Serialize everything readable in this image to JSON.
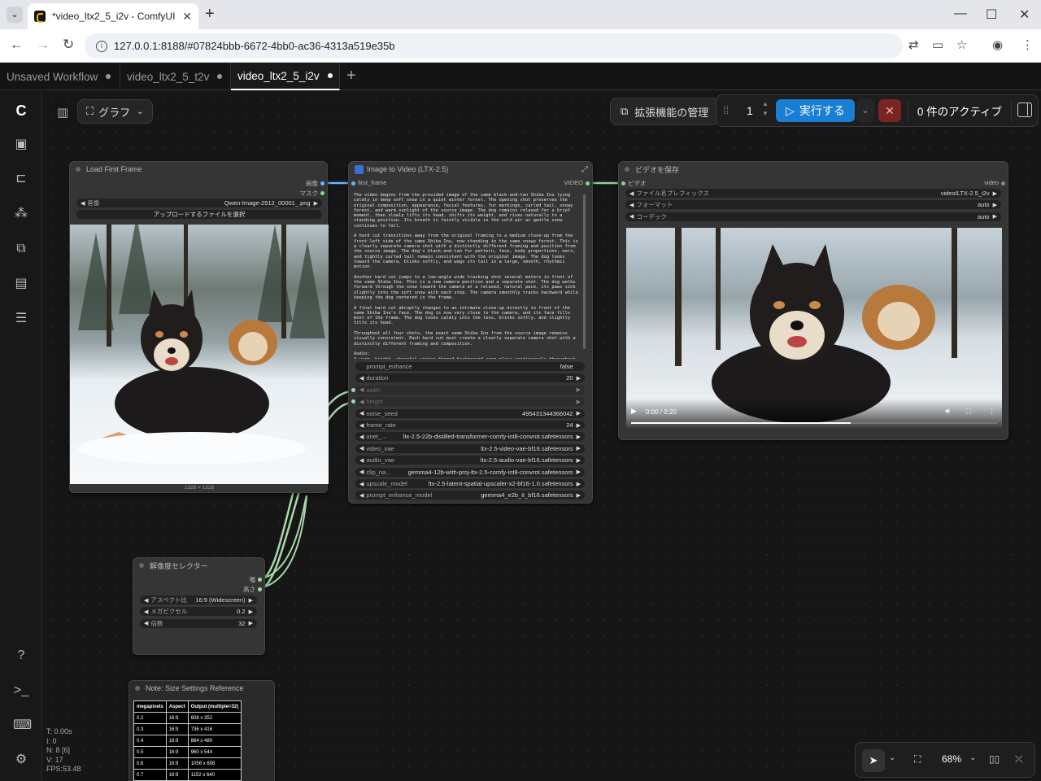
{
  "browser": {
    "tab_title": "*video_ltx2_5_i2v - ComfyUI",
    "url": "127.0.0.1:8188/#07824bbb-6672-4bb0-ac36-4313a519e35b"
  },
  "workflow_tabs": [
    {
      "label": "Unsaved Workflow"
    },
    {
      "label": "video_ltx2_5_t2v"
    },
    {
      "label": "video_ltx2_5_i2v"
    }
  ],
  "toolbar": {
    "graph_label": "グラフ",
    "extensions_label": "拡張機能の管理",
    "queue_count": "1",
    "run_label": "実行する",
    "active_label": "0 件のアクティブ"
  },
  "nodes": {
    "load_first_frame": {
      "title": "Load First Frame",
      "out_image": "画像",
      "out_mask": "マスク",
      "image_label": "画像",
      "image_value": "Qwen-Image-2512_00001_.png",
      "upload_label": "アップロードするファイルを選択",
      "size_caption": "1328 × 1328"
    },
    "image_to_video": {
      "title": "Image to Video (LTX-2.5)",
      "in_first_frame": "first_frame",
      "out_video": "VIDEO",
      "prompt_text": "The video begins from the provided image of the same black-and-tan Shiba Inu lying calmly in deep soft snow in a quiet winter forest. The opening shot preserves the original composition, appearance, facial features, fur markings, curled tail, snowy forest, and warm sunlight of the source image. The dog remains relaxed for a brief moment, then slowly lifts its head, shifts its weight, and rises naturally to a standing position. Its breath is faintly visible in the cold air as gentle snow continues to fall.\n\nA hard cut transitions away from the original framing to a medium close-up from the front-left side of the same Shiba Inu, now standing in the same snowy forest. This is a clearly separate camera shot with a distinctly different framing and position from the source image. The dog's black-and-tan fur pattern, face, body proportions, ears, and tightly curled tail remain consistent with the original image. The dog looks toward the camera, blinks softly, and wags its tail in a large, smooth, rhythmic motion.\n\nAnother hard cut jumps to a low-angle wide tracking shot several meters in front of the same Shiba Inu. This is a new camera position and a separate shot. The dog walks forward through the snow toward the camera at a relaxed, natural pace, its paws sink slightly into the soft snow with each step. The camera smoothly tracks backward while keeping the dog centered in the frame.\n\nA final hard cut abruptly changes to an intimate close-up directly in front of the same Shiba Inu's face. The dog is now very close to the camera, and its face fills most of the frame. The dog looks calmly into the lens, blinks softly, and slightly tilts its head.\n\nThroughout all four shots, the exact same Shiba Inu from the source image remains visually consistent. Each hard cut must create a clearly separate camera shot with a distinctly different framing and composition.\n\nAudio:\nA warm, bright, cheerful winter-themed background song plays continuously throughout the entire video.",
      "widgets": [
        {
          "label": "prompt_enhance",
          "value": "false"
        },
        {
          "label": "duration",
          "value": "20"
        },
        {
          "label": "width",
          "value": ""
        },
        {
          "label": "height",
          "value": ""
        },
        {
          "label": "noise_seed",
          "value": "495431344366042"
        },
        {
          "label": "frame_rate",
          "value": "24"
        },
        {
          "label": "unet_...",
          "value": "ltx-2.5-22b-distilled-transformer-comfy-int8-convrot.safetensors"
        },
        {
          "label": "video_vae",
          "value": "ltx-2.5-video-vae-bf16.safetensors"
        },
        {
          "label": "audio_vae",
          "value": "ltx-2.5-audio-vae-bf16.safetensors"
        },
        {
          "label": "clip_na...",
          "value": "gemma4-12b-with-proj-ltx-2.5-comfy-int8-convrot.safetensors"
        },
        {
          "label": "upscale_model",
          "value": "ltx-2.5-latent-spatial-upscaler-x2-bf16-1.0.safetensors"
        },
        {
          "label": "prompt_enhance_model",
          "value": "gemma4_e2b_it_bf16.safetensors"
        }
      ]
    },
    "save_video": {
      "title": "ビデオを保存",
      "in_video": "ビデオ",
      "out_video": "video",
      "widgets": [
        {
          "label": "ファイル名プレフィックス",
          "value": "video/LTX-2.5_i2v"
        },
        {
          "label": "フォーマット",
          "value": "auto"
        },
        {
          "label": "コーデック",
          "value": "auto"
        }
      ],
      "player_time": "0:00 / 0:20",
      "player_progress": 0.6
    },
    "resolution_selector": {
      "title": "解像度セレクター",
      "out_width": "幅",
      "out_height": "高さ",
      "widgets": [
        {
          "label": "アスペクト比",
          "value": "16:9 (Widescreen)"
        },
        {
          "label": "メガピクセル",
          "value": "0.2"
        },
        {
          "label": "倍数",
          "value": "32"
        }
      ]
    },
    "note": {
      "title": "Note: Size Settings Reference",
      "headers": [
        "megapixels",
        "Aspect",
        "Output (multiple=32)"
      ],
      "rows": [
        [
          "0.2",
          "16:9",
          "608 x 352"
        ],
        [
          "0.3",
          "16:9",
          "736 x 416"
        ],
        [
          "0.4",
          "16:9",
          "864 x 480"
        ],
        [
          "0.5",
          "16:9",
          "960 x 544"
        ],
        [
          "0.6",
          "16:9",
          "1056 x 608"
        ],
        [
          "0.7",
          "16:9",
          "1152 x 640"
        ]
      ]
    }
  },
  "stats": {
    "t": "T: 0.00s",
    "i": "I: 0",
    "n": "N: 8 [6]",
    "v": "V: 17",
    "fps": "FPS:53.48"
  },
  "view_controls": {
    "zoom": "68%"
  }
}
